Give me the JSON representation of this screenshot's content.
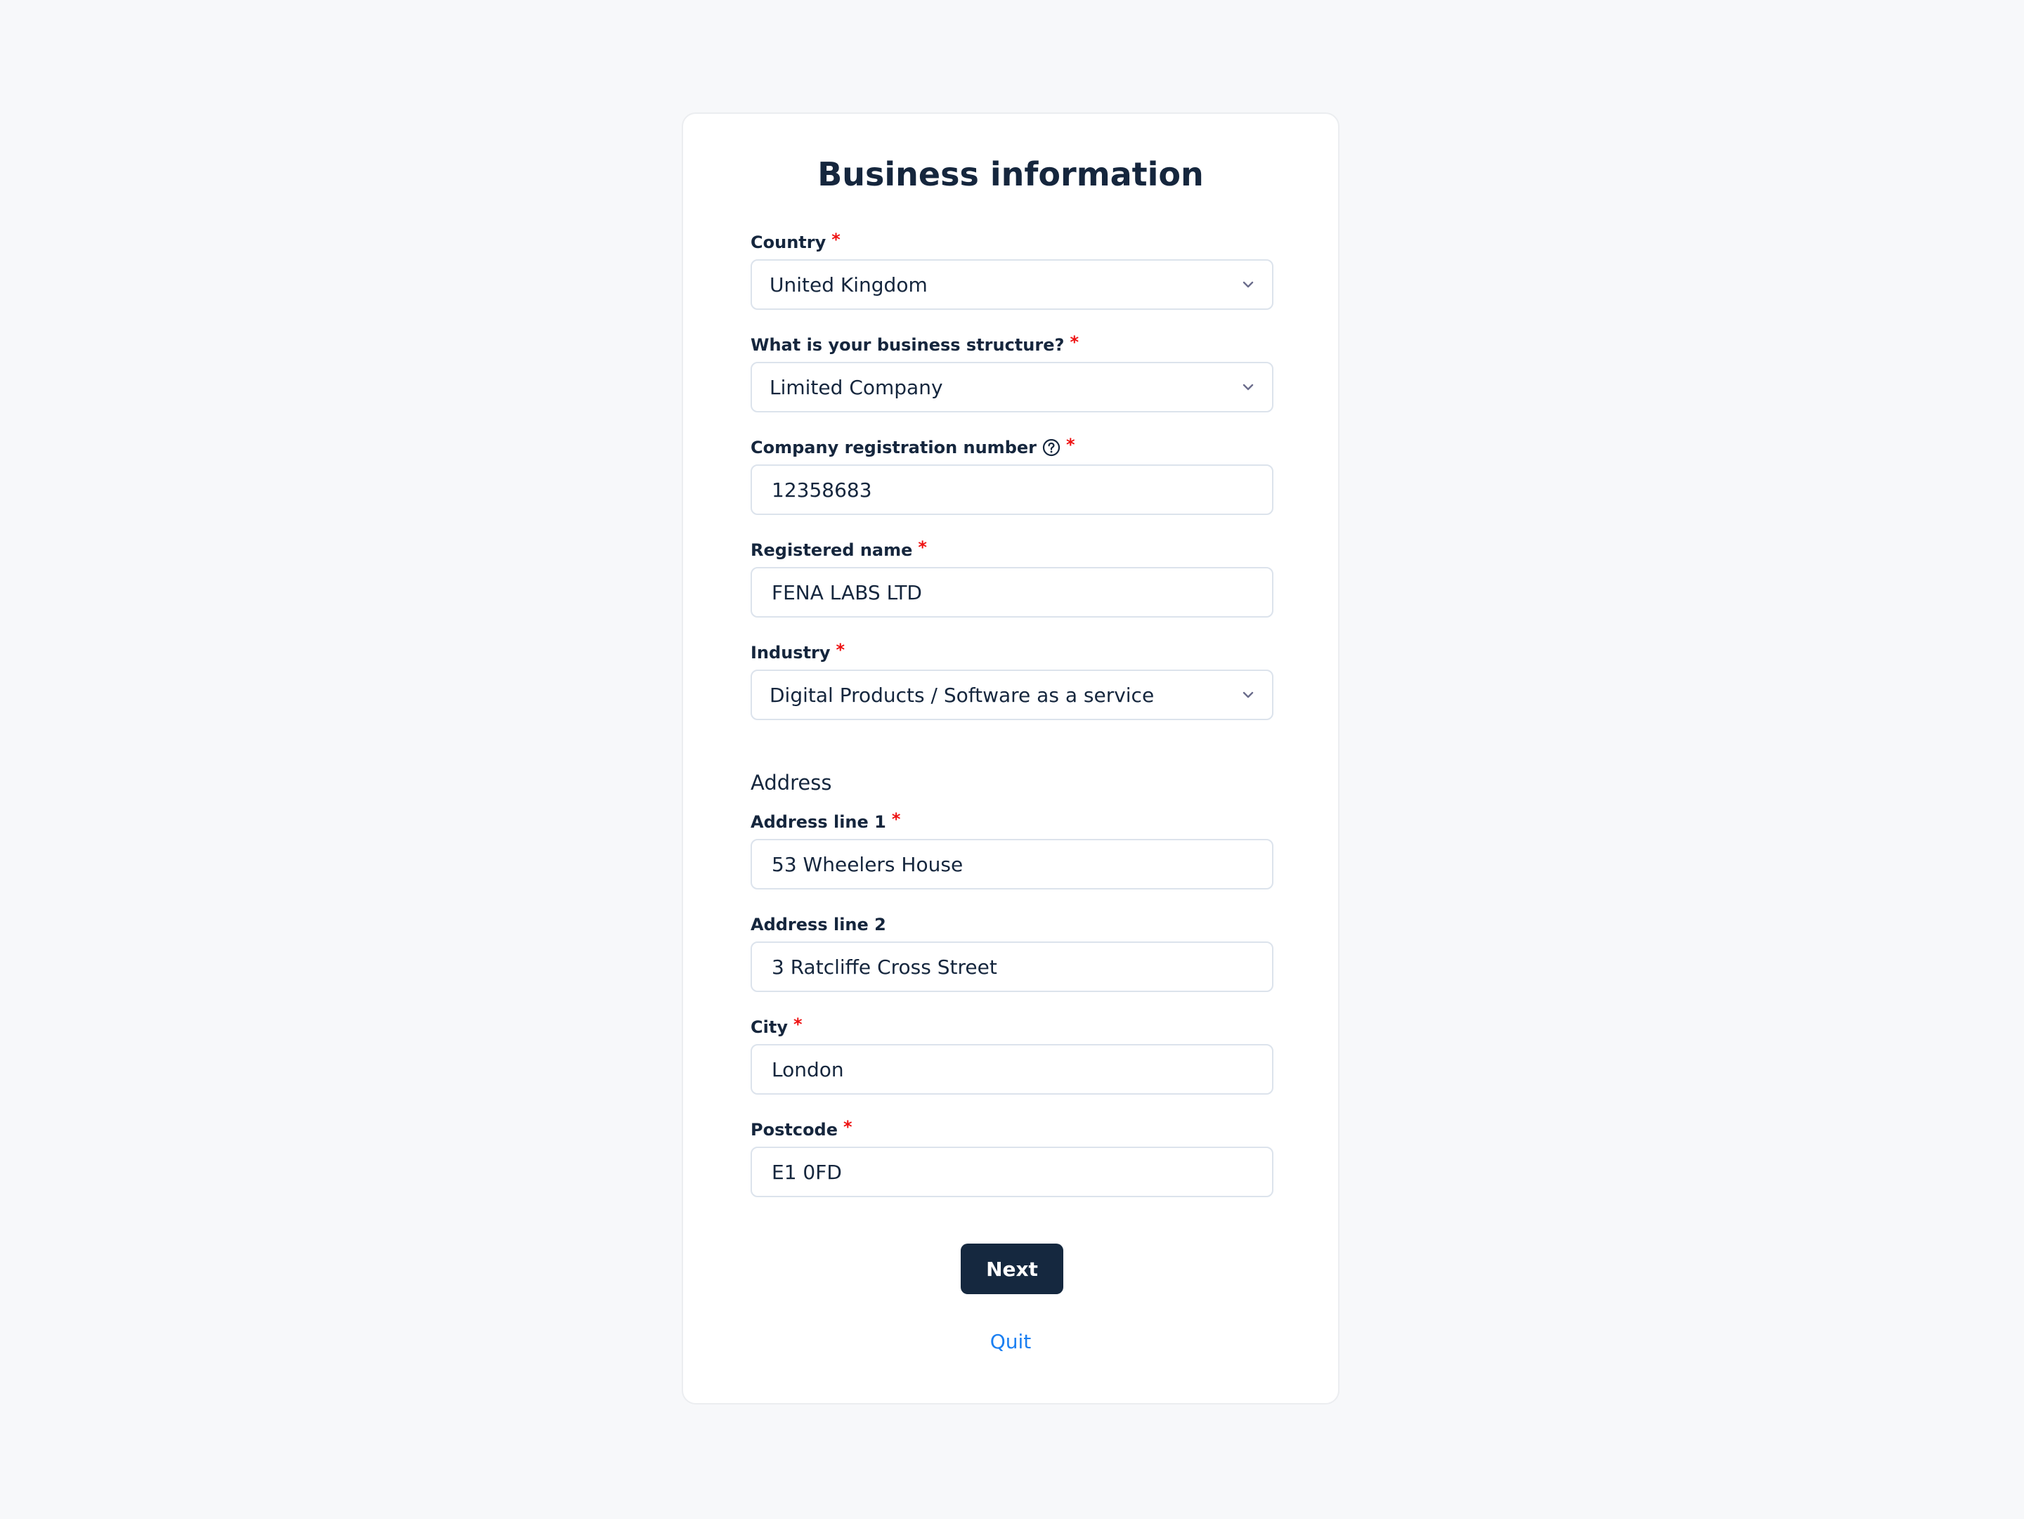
{
  "page": {
    "title": "Business information"
  },
  "fields": {
    "country": {
      "label": "Country",
      "required_mark": "*",
      "value": "United Kingdom",
      "type": "select"
    },
    "business_structure": {
      "label": "What is your business structure?",
      "required_mark": "*",
      "value": "Limited Company",
      "type": "select"
    },
    "company_registration_number": {
      "label": "Company registration number",
      "help_icon": "question-circle-icon",
      "required_mark": "*",
      "value": "12358683",
      "type": "text"
    },
    "registered_name": {
      "label": "Registered name",
      "required_mark": "*",
      "value": "FENA LABS LTD",
      "type": "text"
    },
    "industry": {
      "label": "Industry",
      "required_mark": "*",
      "value": "Digital Products / Software as a service",
      "type": "select"
    }
  },
  "address": {
    "heading": "Address",
    "line1": {
      "label": "Address line 1",
      "required_mark": "*",
      "value": "53 Wheelers House"
    },
    "line2": {
      "label": "Address line 2",
      "value": "3 Ratcliffe Cross Street"
    },
    "city": {
      "label": "City",
      "required_mark": "*",
      "value": "London"
    },
    "postcode": {
      "label": "Postcode",
      "required_mark": "*",
      "value": "E1 0FD"
    }
  },
  "actions": {
    "next_label": "Next",
    "quit_label": "Quit"
  },
  "colors": {
    "page_background": "#f7f8fa",
    "card_background": "#ffffff",
    "text_primary": "#15263d",
    "required_asterisk": "#ee1111",
    "input_border": "#dce3ec",
    "primary_button": "#15283f",
    "link": "#1a7ff2",
    "chevron": "#6b6d8c"
  }
}
